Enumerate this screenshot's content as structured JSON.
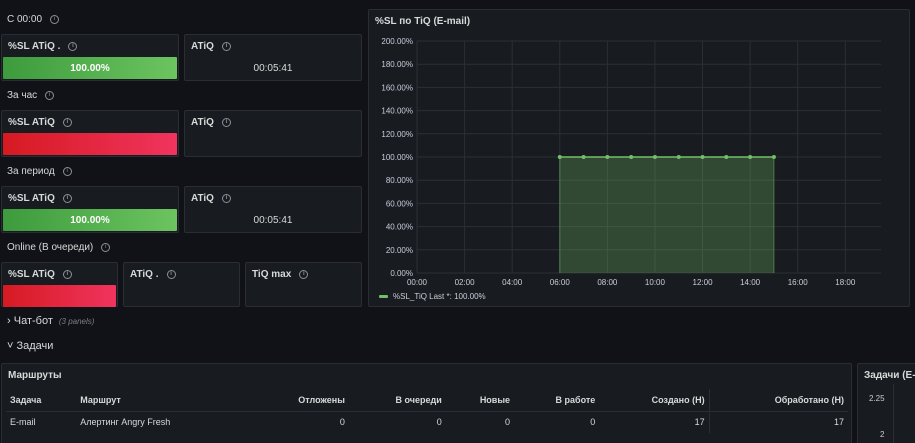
{
  "rows": {
    "today": "С 00:00",
    "hour": "За час",
    "period": "За период",
    "online": "Online (В очереди)"
  },
  "panels": {
    "sl_label": "%SL ATiQ",
    "sl_label_dot": "%SL ATiQ .",
    "atiq": "ATiQ",
    "atiq_dot": "ATiQ .",
    "tiq_max": "TiQ max",
    "today_sl_value": "100.00%",
    "today_atiq_value": "00:05:41",
    "period_sl_value": "100.00%",
    "period_atiq_value": "00:05:41"
  },
  "chart_panel_title": "%SL по TiQ (E-mail)",
  "chart_data": {
    "type": "area",
    "title": "%SL по TiQ (E-mail)",
    "x": [
      "06:00",
      "07:00",
      "08:00",
      "09:00",
      "10:00",
      "11:00",
      "12:00",
      "13:00",
      "14:00",
      "15:00"
    ],
    "series": [
      {
        "name": "%SL_TiQ",
        "values": [
          100,
          100,
          100,
          100,
          100,
          100,
          100,
          100,
          100,
          100
        ],
        "color": "#73bf69"
      }
    ],
    "xticks": [
      "00:00",
      "02:00",
      "04:00",
      "06:00",
      "08:00",
      "10:00",
      "12:00",
      "14:00",
      "16:00",
      "18:00"
    ],
    "yticks": [
      "0.00%",
      "20.00%",
      "40.00%",
      "60.00%",
      "80.00%",
      "100.00%",
      "120.00%",
      "140.00%",
      "160.00%",
      "180.00%",
      "200.00%"
    ],
    "xlim": [
      0,
      19.5
    ],
    "ylim": [
      0,
      200
    ],
    "grid": true,
    "legend": "bottom-left",
    "legend_text": "%SL_TiQ  Last *: 100.00%"
  },
  "sections": {
    "chatbot": "Чат-бот",
    "chatbot_note": "(3 panels)",
    "tasks": "Задачи"
  },
  "routes": {
    "title": "Маршруты",
    "headers": [
      "Задача",
      "Маршрут",
      "Отложены",
      "В очереди",
      "Новые",
      "В работе",
      "Создано (Н)",
      "Обработано (Н)"
    ],
    "rows": [
      [
        "E-mail",
        "Алертинг Angry Fresh",
        "0",
        "0",
        "0",
        "0",
        "17",
        "17"
      ]
    ]
  },
  "side_panel": {
    "title": "Задачи (E-m",
    "ticks": [
      "2.25",
      "2"
    ]
  },
  "colors": {
    "green": "#73bf69",
    "red": "#f2495c",
    "panel_bg": "#181b1f"
  }
}
